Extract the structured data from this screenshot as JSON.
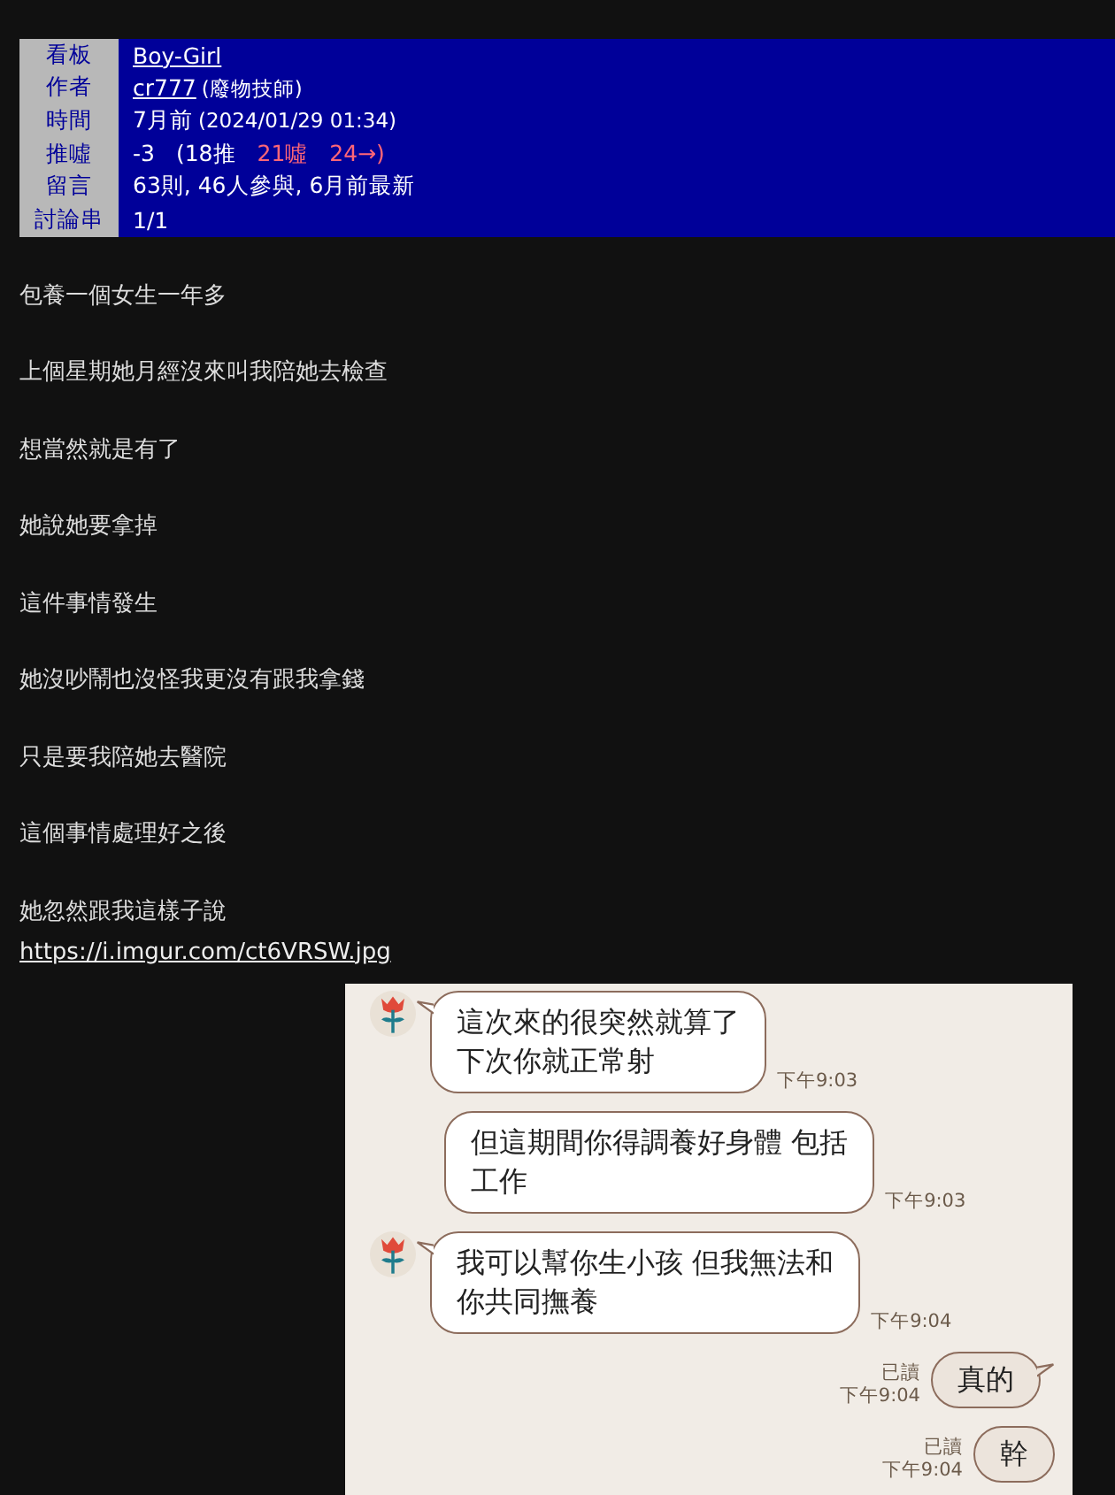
{
  "header": [
    {
      "label": "看板",
      "kind": "link",
      "value": "Boy-Girl"
    },
    {
      "label": "作者",
      "kind": "author",
      "value": "cr777",
      "note": "(廢物技師)"
    },
    {
      "label": "時間",
      "kind": "time",
      "value": "7月前",
      "note": "(2024/01/29 01:34)"
    },
    {
      "label": "推噓",
      "kind": "votes",
      "value": "-3",
      "push": "(18推",
      "boo": "21噓",
      "arrow": "24→)"
    },
    {
      "label": "留言",
      "kind": "text",
      "value": "63則, 46人參與, 6月前最新"
    },
    {
      "label": "討論串",
      "kind": "text",
      "value": "1/1"
    }
  ],
  "paragraphs": [
    "包養一個女生一年多",
    "上個星期她月經沒來叫我陪她去檢查",
    "想當然就是有了",
    "她說她要拿掉",
    "這件事情發生",
    "她沒吵鬧也沒怪我更沒有跟我拿錢",
    "只是要我陪她去醫院",
    "這個事情處理好之後",
    "她忽然跟我這樣子說"
  ],
  "link": "https://i.imgur.com/ct6VRSW.jpg",
  "chat": [
    {
      "kind": "received",
      "avatar": true,
      "lines": [
        "這次來的很突然就算了",
        "下次你就正常射"
      ],
      "time": "下午9:03"
    },
    {
      "kind": "received",
      "avatar": false,
      "lines": [
        "但這期間你得調養好身體 包括",
        "工作"
      ],
      "time": "下午9:03"
    },
    {
      "kind": "received",
      "avatar": true,
      "lines": [
        "我可以幫你生小孩 但我無法和",
        "你共同撫養"
      ],
      "time": "下午9:04"
    },
    {
      "kind": "sent",
      "tail": true,
      "lines": [
        "真的"
      ],
      "read": "已讀",
      "time": "下午9:04"
    },
    {
      "kind": "sent",
      "tail": false,
      "lines": [
        "幹"
      ],
      "read": "已讀",
      "time": "下午9:04"
    }
  ]
}
